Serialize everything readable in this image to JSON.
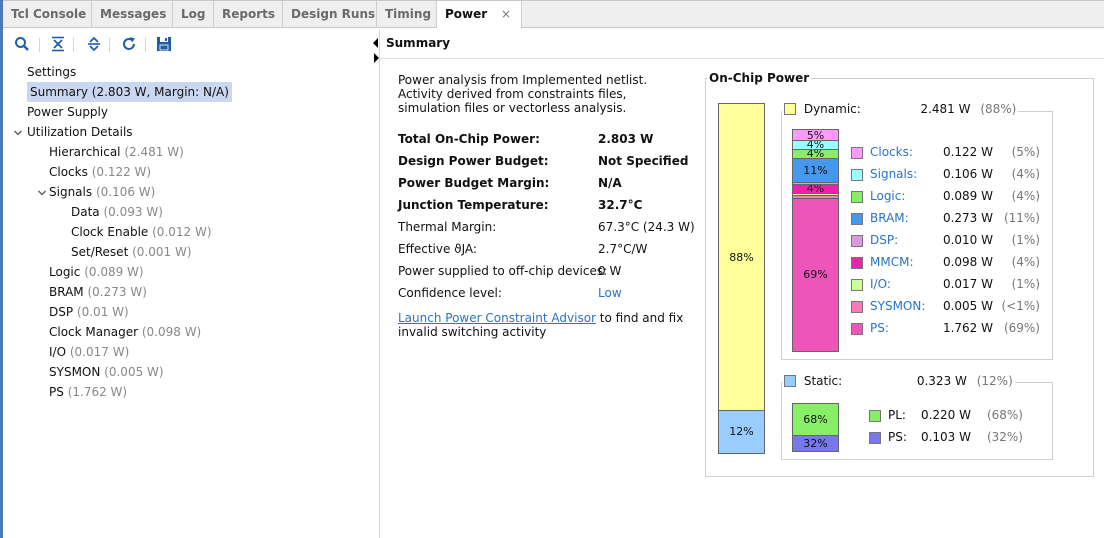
{
  "tabs": [
    "Tcl Console",
    "Messages",
    "Log",
    "Reports",
    "Design Runs",
    "Timing",
    "Power"
  ],
  "tab_close": "×",
  "toolbar": {
    "icons": [
      "search-icon",
      "collapse-all-icon",
      "expand-all-icon",
      "refresh-icon",
      "save-icon"
    ]
  },
  "tree": {
    "settings": "Settings",
    "summary": "Summary (2.803 W, Margin: N/A)",
    "power_supply": "Power Supply",
    "utilization": "Utilization Details",
    "hierarchical": "Hierarchical",
    "hierarchical_v": "(2.481 W)",
    "clocks": "Clocks",
    "clocks_v": "(0.122 W)",
    "signals": "Signals",
    "signals_v": "(0.106 W)",
    "data": "Data",
    "data_v": "(0.093 W)",
    "clock_enable": "Clock Enable",
    "clock_enable_v": "(0.012 W)",
    "set_reset": "Set/Reset",
    "set_reset_v": "(0.001 W)",
    "logic": "Logic",
    "logic_v": "(0.089 W)",
    "bram": "BRAM",
    "bram_v": "(0.273 W)",
    "dsp": "DSP",
    "dsp_v": "(0.01 W)",
    "clock_manager": "Clock Manager",
    "clock_manager_v": "(0.098 W)",
    "io": "I/O",
    "io_v": "(0.017 W)",
    "sysmon": "SYSMON",
    "sysmon_v": "(0.005 W)",
    "ps": "PS",
    "ps_v": "(1.762 W)"
  },
  "summary": {
    "header": "Summary",
    "intro": "Power analysis from Implemented netlist. Activity derived from constraints files, simulation files or vectorless analysis.",
    "rows": [
      {
        "label": "Total On-Chip Power:",
        "value": "2.803 W",
        "bold": true
      },
      {
        "label": "Design Power Budget:",
        "value": "Not Specified",
        "bold": true
      },
      {
        "label": "Power Budget Margin:",
        "value": "N/A",
        "bold": true
      },
      {
        "label": "Junction Temperature:",
        "value": "32.7°C",
        "bold": true
      },
      {
        "label": "Thermal Margin:",
        "value": "67.3°C (24.3 W)",
        "bold": false
      },
      {
        "label": "Effective ϑJA:",
        "value": "2.7°C/W",
        "bold": false
      },
      {
        "label": "Power supplied to off-chip devices:",
        "value": "0 W",
        "bold": false
      },
      {
        "label": "Confidence level:",
        "value": "Low",
        "bold": false
      }
    ],
    "advisor_link": "Launch Power Constraint Advisor",
    "advisor_rest": " to find and fix invalid switching activity"
  },
  "chart_data": {
    "type": "bar",
    "title": "On-Chip Power",
    "overall": [
      {
        "name": "Dynamic",
        "value_w": 2.481,
        "pct": 88,
        "color": "#ffff99",
        "label": "88%"
      },
      {
        "name": "Static",
        "value_w": 0.323,
        "pct": 12,
        "color": "#99ccff",
        "label": "12%"
      }
    ],
    "dynamic": {
      "label": "Dynamic:",
      "value": "2.481 W",
      "pct": "(88%)",
      "items": [
        {
          "name": "Clocks",
          "value": "0.122 W",
          "pct": "(5%)",
          "color": "#ff99ff",
          "share": 5,
          "bar_label": "5%"
        },
        {
          "name": "Signals",
          "value": "0.106 W",
          "pct": "(4%)",
          "color": "#99ffff",
          "share": 4,
          "bar_label": "4%"
        },
        {
          "name": "Logic",
          "value": "0.089 W",
          "pct": "(4%)",
          "color": "#88ee66",
          "share": 4,
          "bar_label": "4%"
        },
        {
          "name": "BRAM",
          "value": "0.273 W",
          "pct": "(11%)",
          "color": "#4499ee",
          "share": 11,
          "bar_label": "11%"
        },
        {
          "name": "DSP",
          "value": "0.010 W",
          "pct": "(1%)",
          "color": "#dd99dd",
          "share": 1,
          "bar_label": ""
        },
        {
          "name": "MMCM",
          "value": "0.098 W",
          "pct": "(4%)",
          "color": "#ee22aa",
          "share": 4,
          "bar_label": "4%"
        },
        {
          "name": "I/O",
          "value": "0.017 W",
          "pct": "(1%)",
          "color": "#ccff99",
          "share": 1,
          "bar_label": ""
        },
        {
          "name": "SYSMON",
          "value": "0.005 W",
          "pct": "(<1%)",
          "color": "#ff77bb",
          "share": 1,
          "bar_label": ""
        },
        {
          "name": "PS",
          "value": "1.762 W",
          "pct": "(69%)",
          "color": "#ee55bb",
          "share": 69,
          "bar_label": "69%"
        }
      ]
    },
    "static": {
      "label": "Static:",
      "value": "0.323 W",
      "pct": "(12%)",
      "items": [
        {
          "name": "PL:",
          "value": "0.220 W",
          "pct": "(68%)",
          "color": "#88ee66",
          "share": 68,
          "bar_label": "68%"
        },
        {
          "name": "PS:",
          "value": "0.103 W",
          "pct": "(32%)",
          "color": "#7777ee",
          "share": 32,
          "bar_label": "32%"
        }
      ]
    }
  }
}
